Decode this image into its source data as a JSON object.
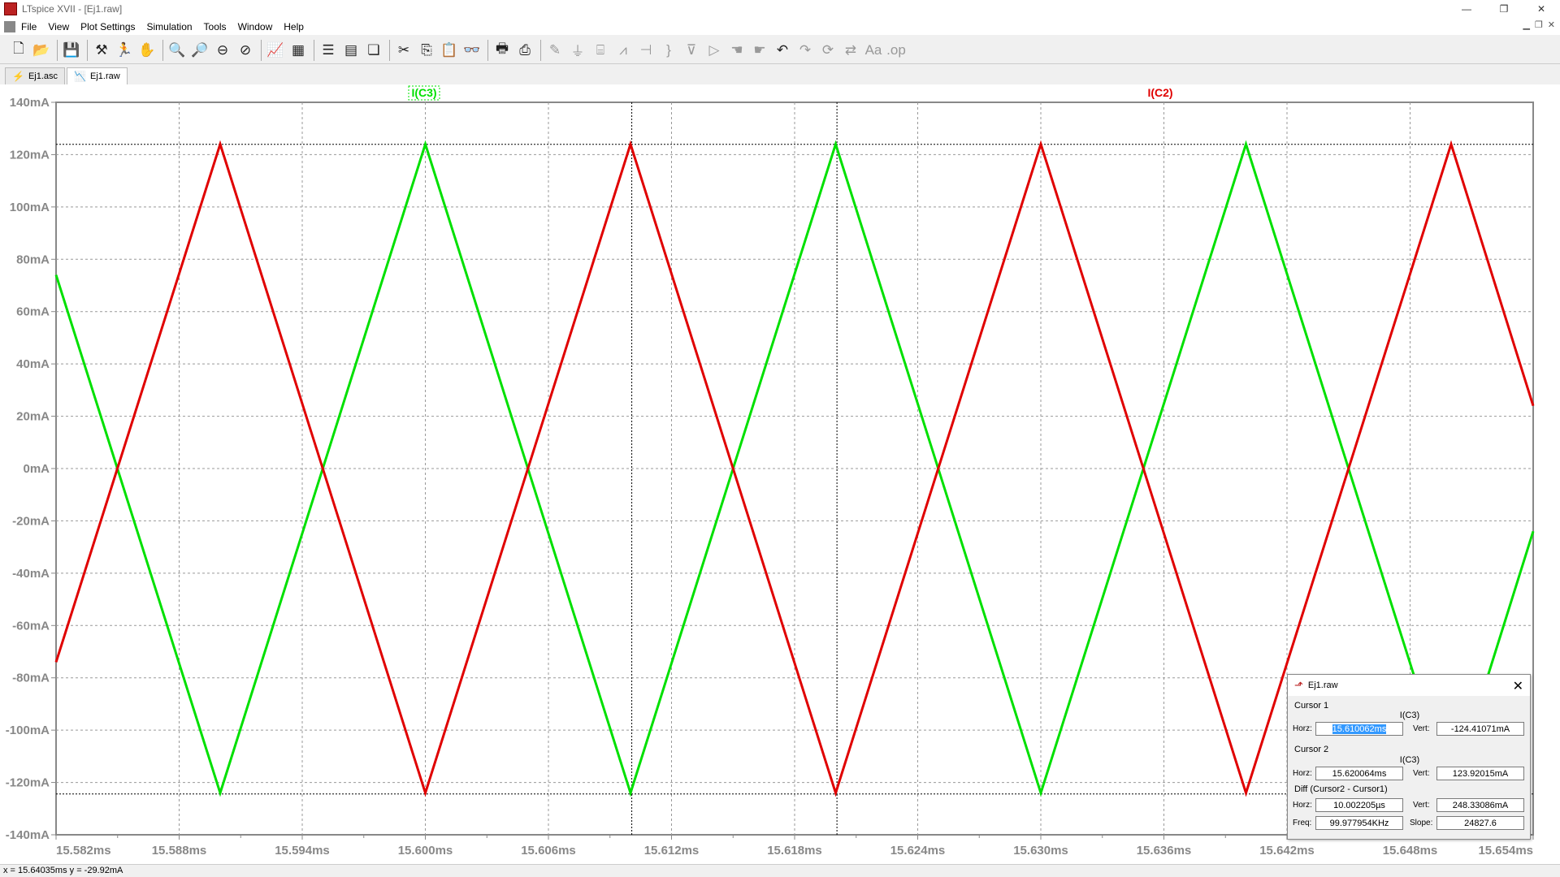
{
  "app": {
    "title": "LTspice XVII - [Ej1.raw]"
  },
  "window_controls": {
    "minimize": "—",
    "restore": "❐",
    "close": "✕"
  },
  "menu": [
    "File",
    "View",
    "Plot Settings",
    "Simulation",
    "Tools",
    "Window",
    "Help"
  ],
  "toolbar_icons": [
    "new-schematic-icon",
    "open-icon",
    "save-icon",
    "control-panel-icon",
    "run-icon",
    "halt-icon",
    "zoom-in-icon",
    "zoom-out-icon",
    "zoom-fit-icon",
    "zoom-cancel-icon",
    "autorange-icon",
    "mark-icon",
    "tile-horizontal-icon",
    "tile-vertical-icon",
    "cascade-icon",
    "cut-icon",
    "copy-icon",
    "paste-icon",
    "find-icon",
    "print-icon",
    "print-preview-icon",
    "wire-icon",
    "ground-icon",
    "label-icon",
    "resistor-icon",
    "capacitor-icon",
    "inductor-icon",
    "diode-icon",
    "component-icon",
    "move-icon",
    "drag-icon",
    "undo-icon",
    "redo-icon",
    "rotate-icon",
    "mirror-icon",
    "text-icon",
    "spice-directive-icon"
  ],
  "tabs": [
    {
      "label": "Ej1.asc",
      "icon": "schematic-icon"
    },
    {
      "label": "Ej1.raw",
      "icon": "waveform-icon"
    }
  ],
  "plot": {
    "traces": [
      {
        "name": "I(C3)",
        "color": "#00e000"
      },
      {
        "name": "I(C2)",
        "color": "#e00000"
      }
    ],
    "y_ticks": [
      "140mA",
      "120mA",
      "100mA",
      "80mA",
      "60mA",
      "40mA",
      "20mA",
      "0mA",
      "-20mA",
      "-40mA",
      "-60mA",
      "-80mA",
      "-100mA",
      "-120mA",
      "-140mA"
    ],
    "x_ticks": [
      "15.582ms",
      "15.588ms",
      "15.594ms",
      "15.600ms",
      "15.606ms",
      "15.612ms",
      "15.618ms",
      "15.624ms",
      "15.630ms",
      "15.636ms",
      "15.642ms",
      "15.648ms",
      "15.654ms"
    ]
  },
  "chart_data": {
    "type": "line",
    "xlabel": "",
    "ylabel": "",
    "xlim": [
      15.582,
      15.654
    ],
    "ylim": [
      -140,
      140
    ],
    "x_unit": "ms",
    "y_unit": "mA",
    "grid": true,
    "cursors": {
      "vertical_x": [
        15.610062,
        15.620064
      ],
      "horizontal_y": [
        -124.41071,
        123.92015
      ]
    },
    "series": [
      {
        "name": "I(C3)",
        "color": "#00e000",
        "x": [
          15.582,
          15.59,
          15.6,
          15.61,
          15.62,
          15.63,
          15.64,
          15.65,
          15.654
        ],
        "y": [
          74,
          -124,
          124,
          -124,
          124,
          -124,
          124,
          -124,
          -24
        ]
      },
      {
        "name": "I(C2)",
        "color": "#e00000",
        "x": [
          15.582,
          15.59,
          15.6,
          15.61,
          15.62,
          15.63,
          15.64,
          15.65,
          15.654
        ],
        "y": [
          -74,
          124,
          -124,
          124,
          -124,
          124,
          -124,
          124,
          24
        ]
      }
    ]
  },
  "cursor_window": {
    "title": "Ej1.raw",
    "cursor1_label": "Cursor 1",
    "cursor1_trace": "I(C3)",
    "cursor1_horz": "15.610062ms",
    "cursor1_vert": "-124.41071mA",
    "cursor2_label": "Cursor 2",
    "cursor2_trace": "I(C3)",
    "cursor2_horz": "15.620064ms",
    "cursor2_vert": "123.92015mA",
    "diff_label": "Diff (Cursor2 - Cursor1)",
    "diff_horz": "10.002205µs",
    "diff_vert": "248.33086mA",
    "freq": "99.977954KHz",
    "slope": "24827.6",
    "lbl_horz": "Horz:",
    "lbl_vert": "Vert:",
    "lbl_freq": "Freq:",
    "lbl_slope": "Slope:"
  },
  "status": {
    "text": "x = 15.64035ms   y = -29.92mA"
  }
}
